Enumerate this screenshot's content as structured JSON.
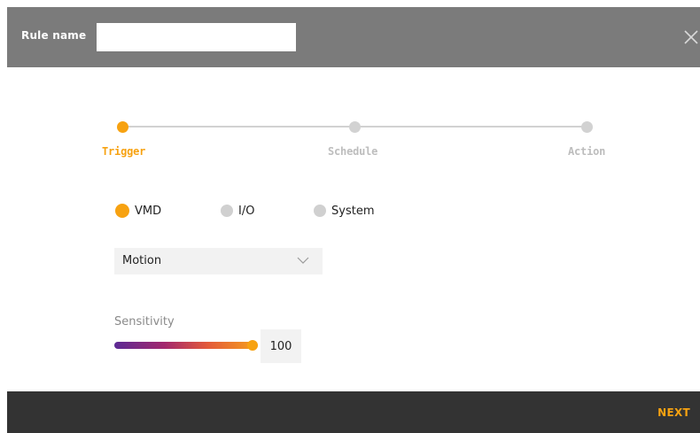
{
  "header": {
    "rule_name_label": "Rule name",
    "rule_name_value": "",
    "close_icon": "close-icon"
  },
  "stepper": {
    "steps": [
      {
        "label": "Trigger",
        "active": true
      },
      {
        "label": "Schedule",
        "active": false
      },
      {
        "label": "Action",
        "active": false
      }
    ]
  },
  "trigger_types": {
    "options": [
      {
        "label": "VMD",
        "selected": true
      },
      {
        "label": "I/O",
        "selected": false
      },
      {
        "label": "System",
        "selected": false
      }
    ]
  },
  "event_select": {
    "value": "Motion"
  },
  "sensitivity": {
    "label": "Sensitivity",
    "value": "100",
    "level_percent": 100
  },
  "footer": {
    "next_label": "NEXT"
  },
  "colors": {
    "accent": "#f7a211",
    "header_bg": "#7b7b7b",
    "footer_bg": "#333333",
    "inactive": "#d2d2d2"
  }
}
